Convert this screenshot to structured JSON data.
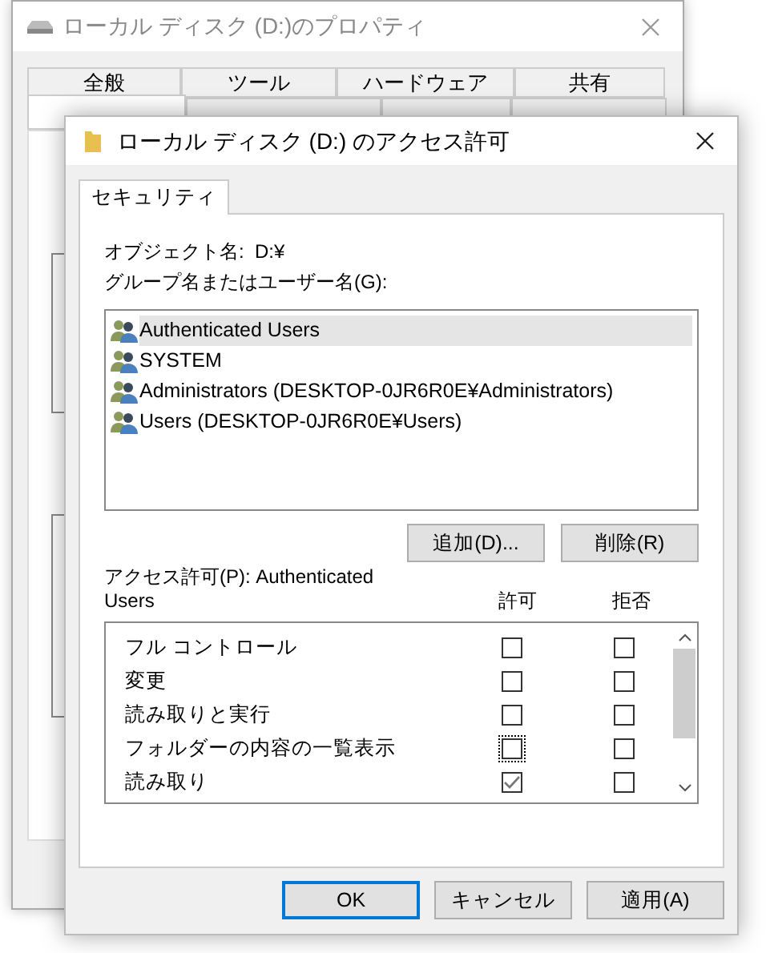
{
  "background_window": {
    "title": "ローカル ディスク (D:)のプロパティ",
    "tabs_row_1": [
      {
        "label": "全般",
        "selected": false
      },
      {
        "label": "ツール",
        "selected": false
      },
      {
        "label": "ハードウェア",
        "selected": false
      },
      {
        "label": "共有",
        "selected": false
      }
    ],
    "tabs_row_2": [
      {
        "selected": true
      },
      {
        "selected": false
      },
      {
        "selected": false
      },
      {
        "selected": false
      }
    ]
  },
  "dialog": {
    "title": "ローカル ディスク (D:) のアクセス許可",
    "tabs": [
      {
        "label": "セキュリティ",
        "selected": true
      }
    ],
    "object_label": "オブジェクト名:",
    "object_value": "D:¥",
    "group_label": "グループ名またはユーザー名(G):",
    "principals": [
      {
        "name": "Authenticated Users",
        "selected": true
      },
      {
        "name": "SYSTEM",
        "selected": false
      },
      {
        "name": "Administrators (DESKTOP-0JR6R0E¥Administrators)",
        "selected": false
      },
      {
        "name": "Users (DESKTOP-0JR6R0E¥Users)",
        "selected": false
      }
    ],
    "list_buttons": [
      "追加(D)...",
      "削除(R)"
    ],
    "permissions_label": "アクセス許可(P): Authenticated Users",
    "columns": [
      "許可",
      "拒否"
    ],
    "permissions": [
      {
        "name": "フル コントロール",
        "allow": false,
        "deny": false,
        "focused": false
      },
      {
        "name": "変更",
        "allow": false,
        "deny": false,
        "focused": false
      },
      {
        "name": "読み取りと実行",
        "allow": false,
        "deny": false,
        "focused": false
      },
      {
        "name": "フォルダーの内容の一覧表示",
        "allow": false,
        "deny": false,
        "focused": true
      },
      {
        "name": "読み取り",
        "allow": true,
        "deny": false,
        "focused": false
      }
    ],
    "footer_buttons": [
      {
        "label": "OK",
        "default": true
      },
      {
        "label": "キャンセル",
        "default": false
      },
      {
        "label": "適用(A)",
        "default": false
      }
    ]
  }
}
